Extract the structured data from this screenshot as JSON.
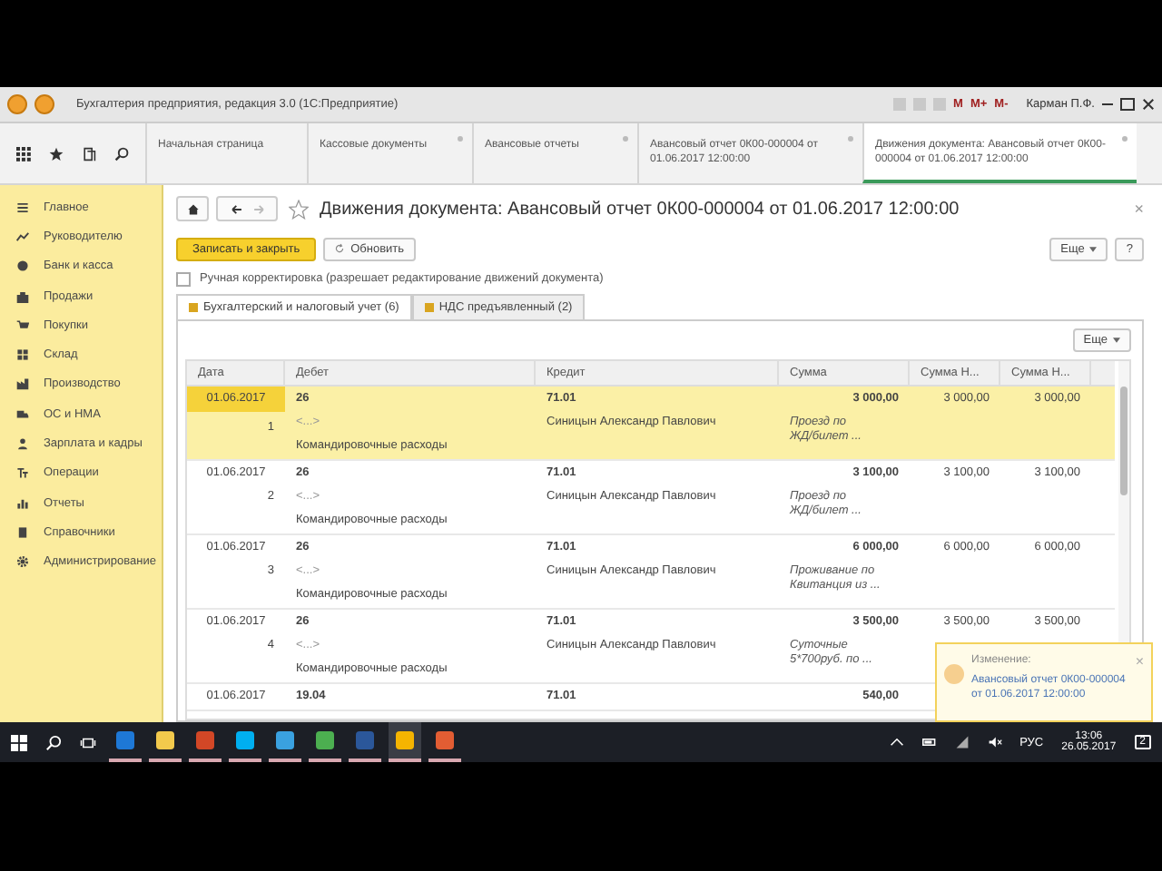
{
  "window": {
    "title": "Бухгалтерия предприятия, редакция 3.0  (1С:Предприятие)",
    "user": "Карман П.Ф.",
    "memory_buttons": [
      "M",
      "M+",
      "M-"
    ]
  },
  "tabs": [
    {
      "label": "Начальная страница",
      "selected": false,
      "closable": false
    },
    {
      "label": "Кассовые документы",
      "selected": false,
      "closable": true
    },
    {
      "label": "Авансовые отчеты",
      "selected": false,
      "closable": true
    },
    {
      "label": "Авансовый отчет 0К00-000004 от 01.06.2017 12:00:00",
      "selected": false,
      "closable": true
    },
    {
      "label": "Движения документа: Авансовый отчет 0К00-000004 от 01.06.2017 12:00:00",
      "selected": true,
      "closable": true
    }
  ],
  "sidebar": {
    "items": [
      {
        "label": "Главное"
      },
      {
        "label": "Руководителю"
      },
      {
        "label": "Банк и касса"
      },
      {
        "label": "Продажи"
      },
      {
        "label": "Покупки"
      },
      {
        "label": "Склад"
      },
      {
        "label": "Производство"
      },
      {
        "label": "ОС и НМА"
      },
      {
        "label": "Зарплата и кадры"
      },
      {
        "label": "Операции"
      },
      {
        "label": "Отчеты"
      },
      {
        "label": "Справочники"
      },
      {
        "label": "Администрирование"
      }
    ]
  },
  "form": {
    "title": "Движения документа: Авансовый отчет 0К00-000004 от 01.06.2017 12:00:00",
    "close": "×",
    "save_button": "Записать и закрыть",
    "refresh_button": "Обновить",
    "more_button": "Еще",
    "help_button": "?",
    "manual_edit": {
      "label": "Ручная корректировка (разрешает редактирование движений документа)",
      "checked": false
    },
    "register_tabs": [
      {
        "label": "Бухгалтерский и налоговый учет (6)",
        "selected": true
      },
      {
        "label": "НДС предъявленный (2)",
        "selected": false
      }
    ],
    "table_more_button": "Еще"
  },
  "table": {
    "columns": [
      "Дата",
      "Дебет",
      "Кредит",
      "Сумма",
      "Сумма Н...",
      "Сумма Н..."
    ],
    "rows": [
      {
        "selected": true,
        "date": "01.06.2017",
        "debit": "26",
        "credit": "71.01",
        "sum": "3 000,00",
        "sum_n1": "3 000,00",
        "sum_n2": "3 000,00",
        "number": "1",
        "debit_sub1": "<...>",
        "credit_sub1": "Синицын Александр Павлович",
        "content": [
          "Проезд по",
          "ЖД/билет ..."
        ],
        "debit_sub2": "Командировочные расходы"
      },
      {
        "selected": false,
        "date": "01.06.2017",
        "debit": "26",
        "credit": "71.01",
        "sum": "3 100,00",
        "sum_n1": "3 100,00",
        "sum_n2": "3 100,00",
        "number": "2",
        "debit_sub1": "<...>",
        "credit_sub1": "Синицын Александр Павлович",
        "content": [
          "Проезд по",
          "ЖД/билет ..."
        ],
        "debit_sub2": "Командировочные расходы"
      },
      {
        "selected": false,
        "date": "01.06.2017",
        "debit": "26",
        "credit": "71.01",
        "sum": "6 000,00",
        "sum_n1": "6 000,00",
        "sum_n2": "6 000,00",
        "number": "3",
        "debit_sub1": "<...>",
        "credit_sub1": "Синицын Александр Павлович",
        "content": [
          "Проживание по",
          "Квитанция из ..."
        ],
        "debit_sub2": "Командировочные расходы"
      },
      {
        "selected": false,
        "date": "01.06.2017",
        "debit": "26",
        "credit": "71.01",
        "sum": "3 500,00",
        "sum_n1": "3 500,00",
        "sum_n2": "3 500,00",
        "number": "4",
        "debit_sub1": "<...>",
        "credit_sub1": "Синицын Александр Павлович",
        "content": [
          "Суточные",
          "5*700руб. по ..."
        ],
        "debit_sub2": "Командировочные расходы"
      },
      {
        "selected": false,
        "date": "01.06.2017",
        "debit": "19.04",
        "credit": "71.01",
        "sum": "540,00"
      }
    ]
  },
  "notification": {
    "title": "Изменение:",
    "link": "Авансовый отчет 0К00-000004 от 01.06.2017 12:00:00",
    "close": "×"
  },
  "taskbar": {
    "apps": [
      {
        "active": false
      },
      {
        "active": false
      },
      {
        "active": false
      },
      {
        "active": false
      },
      {
        "active": false
      },
      {
        "active": false
      },
      {
        "active": false
      },
      {
        "active": true
      },
      {
        "active": false
      }
    ],
    "language": "РУС",
    "time": "13:06",
    "date": "26.05.2017",
    "notifications": "2"
  }
}
